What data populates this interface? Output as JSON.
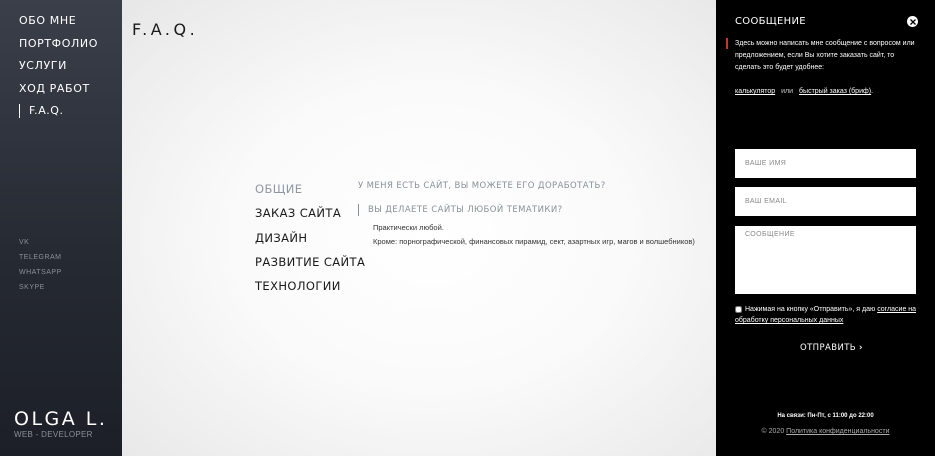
{
  "sidebar": {
    "nav": [
      {
        "label": "Обо мне"
      },
      {
        "label": "Портфолио"
      },
      {
        "label": "Услуги"
      },
      {
        "label": "Ход работ"
      },
      {
        "label": "F.A.Q."
      }
    ],
    "social": [
      {
        "label": "VK"
      },
      {
        "label": "Telegram"
      },
      {
        "label": "WhatsApp"
      },
      {
        "label": "Skype"
      }
    ],
    "brand_name": "OLGA L.",
    "brand_sub": "WEB - DEVELOPER"
  },
  "main": {
    "title": "F.A.Q.",
    "categories": [
      {
        "label": "Общие",
        "active": true
      },
      {
        "label": "Заказ сайта"
      },
      {
        "label": "Дизайн"
      },
      {
        "label": "Развитие сайта"
      },
      {
        "label": "Технологии"
      }
    ],
    "questions": [
      {
        "text": "У меня есть сайт, вы можете его доработать?"
      },
      {
        "text": "Вы делаете сайты любой тематики?"
      }
    ],
    "answer": [
      "Практически любой.",
      "Кроме: порнографической, финансовых пирамид, сект, азартных игр, магов и волшебников)"
    ]
  },
  "panel": {
    "title": "Сообщение",
    "close_icon": "close-icon",
    "intro": "Здесь можно написать мне сообщение с вопросом или предложением, если Вы хотите заказать сайт, то сделать это будет удобнее:",
    "link_calc": "калькулятор",
    "link_sep": "или",
    "link_brief": "быстрый заказ (бриф)",
    "link_end": ".",
    "name_placeholder": "Ваше имя",
    "email_placeholder": "Ваш Email",
    "message_placeholder": "Сообщение",
    "consent_text": "Нажимая на кнопку «Отправить», я даю",
    "consent_link": "согласие на обработку персональных данных",
    "submit_label": "Отправить",
    "hours": "На связи: Пн-Пт, с 11:00 до 22:00",
    "copyright": "© 2020",
    "privacy_link": "Политика конфиденциальности"
  },
  "colors": {
    "sidebar_top": "#3a3f4a",
    "sidebar_bottom": "#1c1f27",
    "panel_bg": "#000000",
    "accent_marker": "#c0392b",
    "muted_text": "#8a8f99"
  }
}
